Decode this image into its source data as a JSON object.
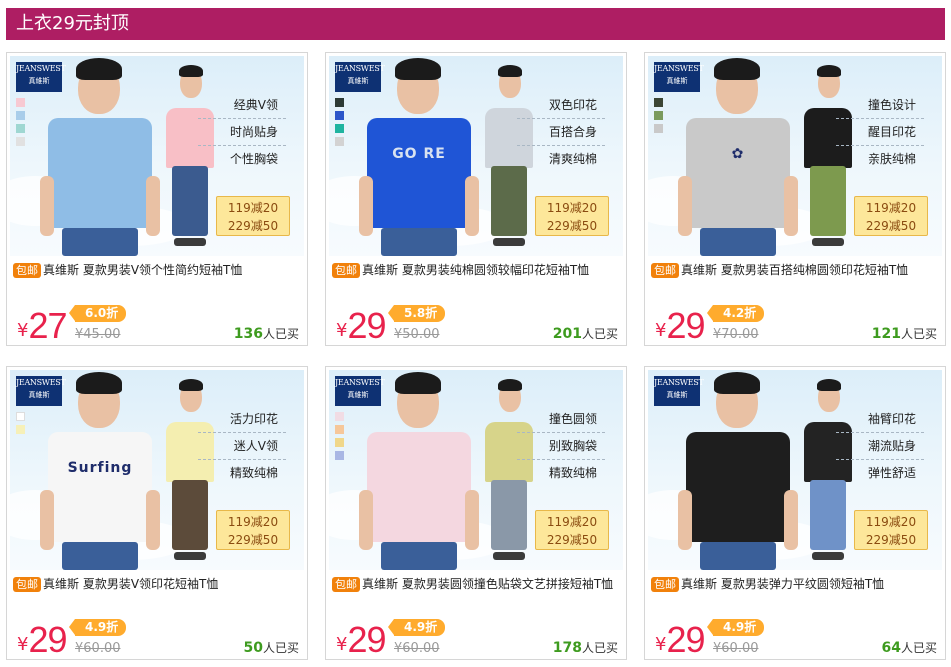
{
  "header": {
    "title": "上衣29元封顶"
  },
  "brand": {
    "logo_line1": "JEANSWEST",
    "logo_line2": "真維斯"
  },
  "common": {
    "baoyou": "包邮",
    "currency": "¥",
    "sold_suffix": "人已买",
    "promo_line1": "119减20",
    "promo_line2": "229减50"
  },
  "products": [
    {
      "features": [
        "经典V领",
        "时尚贴身",
        "个性胸袋"
      ],
      "title": "真维斯 夏款男装V领个性简约短袖T恤",
      "price": "27",
      "discount": "6.0折",
      "original": "¥45.00",
      "sold": "136",
      "swatches": [
        "#f7c9d2",
        "#a9cdea",
        "#9fd7d2",
        "#e1e1e1"
      ],
      "shirt_color": "#8fbde6",
      "shirt2_color": "#f8bfc6",
      "pants2_color": "#3b5b8f",
      "print": ""
    },
    {
      "features": [
        "双色印花",
        "百搭合身",
        "清爽纯棉"
      ],
      "title": "真维斯 夏款男装纯棉圆领较幅印花短袖T恤",
      "price": "29",
      "discount": "5.8折",
      "original": "¥50.00",
      "sold": "201",
      "swatches": [
        "#2d3a35",
        "#2c56c9",
        "#1fb4a0",
        "#d3d3d3"
      ],
      "shirt_color": "#1f55d6",
      "shirt2_color": "#cfd5dc",
      "pants2_color": "#5c6b4a",
      "print": "GO RE"
    },
    {
      "features": [
        "撞色设计",
        "醒目印花",
        "亲肤纯棉"
      ],
      "title": "真维斯 夏款男装百搭纯棉圆领印花短袖T恤",
      "price": "29",
      "discount": "4.2折",
      "original": "¥70.00",
      "sold": "121",
      "swatches": [
        "#3b4534",
        "#7a9a5d",
        "#c9c9c9"
      ],
      "shirt_color": "#c9c9c9",
      "shirt2_color": "#1c1c1c",
      "pants2_color": "#7d9a4e",
      "print": "✿"
    },
    {
      "features": [
        "活力印花",
        "迷人V领",
        "精致纯棉"
      ],
      "title": "真维斯 夏款男装V领印花短袖T恤",
      "price": "29",
      "discount": "4.9折",
      "original": "¥60.00",
      "sold": "50",
      "swatches": [
        "#ffffff",
        "#f6f0b8"
      ],
      "shirt_color": "#f6f6f6",
      "shirt2_color": "#f4eeb0",
      "pants2_color": "#5c4b3a",
      "print": "Surfing"
    },
    {
      "features": [
        "撞色圆领",
        "别致胸袋",
        "精致纯棉"
      ],
      "title": "真维斯 夏款男装圆领撞色贴袋文艺拼接短袖T恤",
      "price": "29",
      "discount": "4.9折",
      "original": "¥60.00",
      "sold": "178",
      "swatches": [
        "#f1dce4",
        "#f6c79a",
        "#f0d78a",
        "#a9b7e4"
      ],
      "shirt_color": "#f4d7e0",
      "shirt2_color": "#d7d48a",
      "pants2_color": "#8a98a8",
      "print": ""
    },
    {
      "features": [
        "袖臂印花",
        "潮流贴身",
        "弹性舒适"
      ],
      "title": "真维斯 夏款男装弹力平纹圆领短袖T恤",
      "price": "29",
      "discount": "4.9折",
      "original": "¥60.00",
      "sold": "64",
      "swatches": [],
      "shirt_color": "#1e1e1e",
      "shirt2_color": "#232323",
      "pants2_color": "#6f92c8",
      "print": ""
    }
  ]
}
